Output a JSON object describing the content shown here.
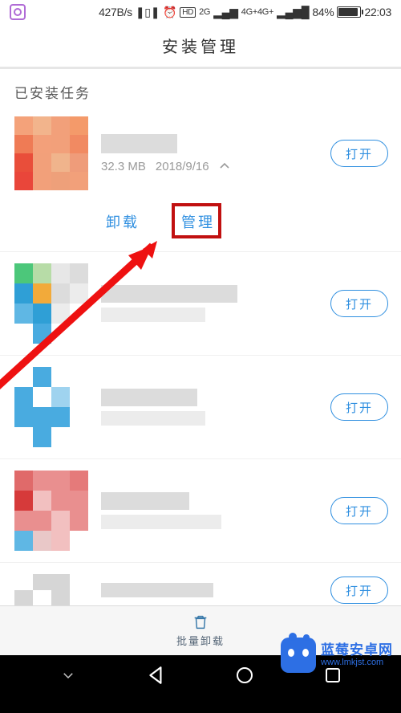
{
  "status_bar": {
    "speed": "427B/s",
    "signal_labels": [
      "2G",
      "4G+4G+"
    ],
    "battery_pct": "84%",
    "time": "22:03",
    "vibrate_icon": "vibrate",
    "alarm_icon": "alarm",
    "hd_icon": "HD"
  },
  "header": {
    "title": "安装管理"
  },
  "section_title": "已安装任务",
  "apps": [
    {
      "size": "32.3 MB",
      "date": "2018/9/16",
      "open_label": "打开",
      "expanded": true
    },
    {
      "open_label": "打开"
    },
    {
      "open_label": "打开"
    },
    {
      "open_label": "打开"
    },
    {
      "open_label": "打开"
    }
  ],
  "expanded_actions": {
    "uninstall": "卸载",
    "manage": "管理"
  },
  "bottom_bar": {
    "batch_uninstall": "批量卸载"
  },
  "watermark": {
    "line1": "蓝莓安卓网",
    "line2": "www.lmkjst.com"
  },
  "colors": {
    "accent": "#2f8fe0",
    "highlight": "#c11010",
    "watermark": "#2d6fe4"
  }
}
